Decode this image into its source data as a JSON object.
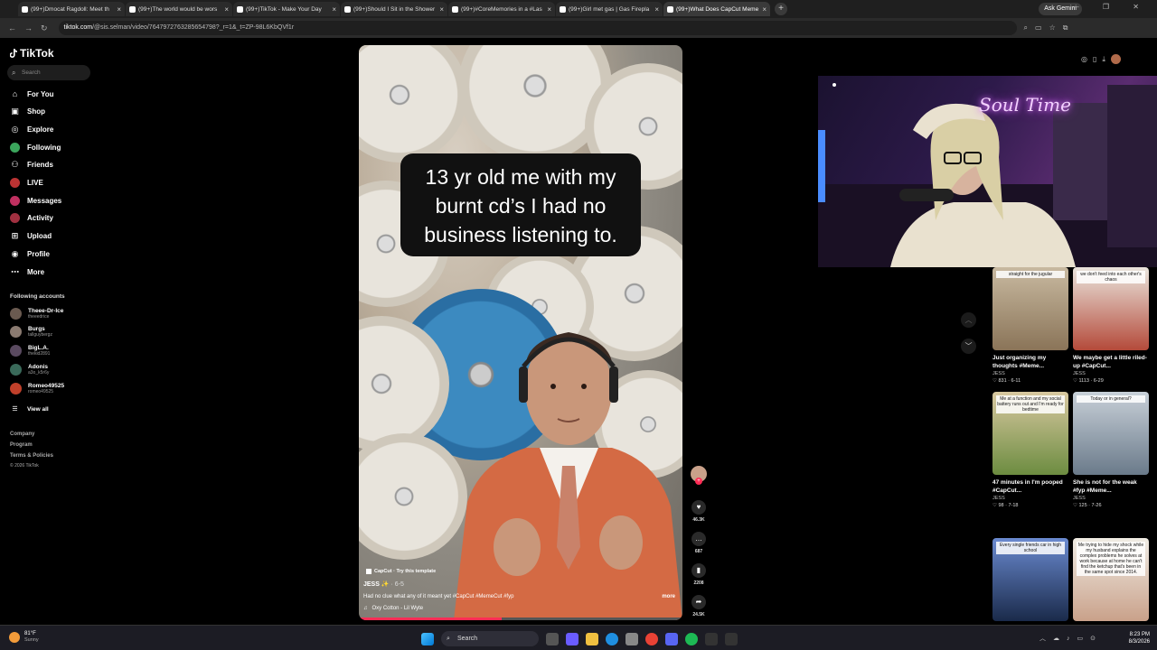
{
  "browser": {
    "tabs": [
      {
        "title": "(99+)Dmocat Ragdoll: Meet th"
      },
      {
        "title": "(99+)The world would be wors"
      },
      {
        "title": "(99+)TikTok - Make Your Day"
      },
      {
        "title": "(99+)Should I Sit in the Shower"
      },
      {
        "title": "(99+)#CoreMemories in a #Las"
      },
      {
        "title": "(99+)Girl met gas | Gas Firepla"
      },
      {
        "title": "(99+)What Does CapCut Meme"
      }
    ],
    "gemini_label": "Ask Gemini",
    "url_host": "tiktok.com",
    "url_path": "/@sis.selman/video/7647972763285654798?_r=1&_t=ZP-98L6KbQVf1r"
  },
  "sidebar": {
    "logo": "TikTok",
    "search_placeholder": "Search",
    "nav": [
      {
        "label": "For You",
        "icon": "home-icon"
      },
      {
        "label": "Shop",
        "icon": "shop-icon"
      },
      {
        "label": "Explore",
        "icon": "compass-icon"
      },
      {
        "label": "Following",
        "icon": "following-icon"
      },
      {
        "label": "Friends",
        "icon": "friends-icon"
      },
      {
        "label": "LIVE",
        "icon": "live-icon"
      },
      {
        "label": "Messages",
        "icon": "messages-icon"
      },
      {
        "label": "Activity",
        "icon": "activity-icon"
      },
      {
        "label": "Upload",
        "icon": "upload-icon"
      },
      {
        "label": "Profile",
        "icon": "profile-icon"
      },
      {
        "label": "More",
        "icon": "more-icon"
      }
    ],
    "following_title": "Following accounts",
    "accounts": [
      {
        "name": "Theee-Dr-Ice",
        "handle": "theeedrice"
      },
      {
        "name": "Burgs",
        "handle": "tallguybergz"
      },
      {
        "name": "BigL.A.",
        "handle": "thekid2891"
      },
      {
        "name": "Adonis",
        "handle": "a3o_k5r6y"
      },
      {
        "name": "Romeo49525",
        "handle": "romeo49525"
      }
    ],
    "view_all": "View all",
    "footer": {
      "company": "Company",
      "program": "Program",
      "terms": "Terms & Policies",
      "copyright": "© 2026 TikTok"
    }
  },
  "video": {
    "caption": "13 yr old me with my burnt cd’s I had no business listening to.",
    "capcut": "CapCut · Try this template",
    "author": "JESS",
    "date": "· 6-5",
    "description": "Had no clue what any of it meant yet #CapCut #MemeCut #fyp",
    "more": "more",
    "music": "Oxy Cotton - Lil Wyte",
    "progress": 0.44
  },
  "actions": {
    "likes": "46.3K",
    "comments": "687",
    "saves": "2208",
    "shares": "24.5K"
  },
  "webcam": {
    "sign": "Soul Time"
  },
  "related": [
    {
      "title": "Just organizing my thoughts #Meme...",
      "author": "JESS",
      "stats": "831 · 6-11",
      "thumb_text": "straight for the jugular"
    },
    {
      "title": "We maybe get a little riled-up #CapCut...",
      "author": "JESS",
      "stats": "1113 · 6-29",
      "thumb_text": "we don't feed into each other's chaos"
    },
    {
      "title": "47 minutes in I'm pooped #CapCut...",
      "author": "JESS",
      "stats": "98 · 7-18",
      "thumb_text": "Me at a function and my social battery runs out and I'm ready for bedtime"
    },
    {
      "title": "She is not for the weak #fyp #Meme...",
      "author": "JESS",
      "stats": "125 · 7-26",
      "thumb_text": "Today or in general?"
    },
    {
      "title": "",
      "author": "",
      "stats": "",
      "thumb_text": "Every single friends car in high school"
    },
    {
      "title": "",
      "author": "",
      "stats": "",
      "thumb_text": "Me trying to hide my shock while my husband explains the complex problems he solves at work because at home he can't find the ketchup that's been in the same spot since 2014."
    }
  ],
  "taskbar": {
    "temp": "81°F",
    "weather": "Sunny",
    "search": "Search",
    "time": "8:23 PM",
    "date": "8/3/2026"
  },
  "colors": {
    "accent": "#fe2c55",
    "background": "#000000",
    "sidebar_text": "#ffffff"
  }
}
